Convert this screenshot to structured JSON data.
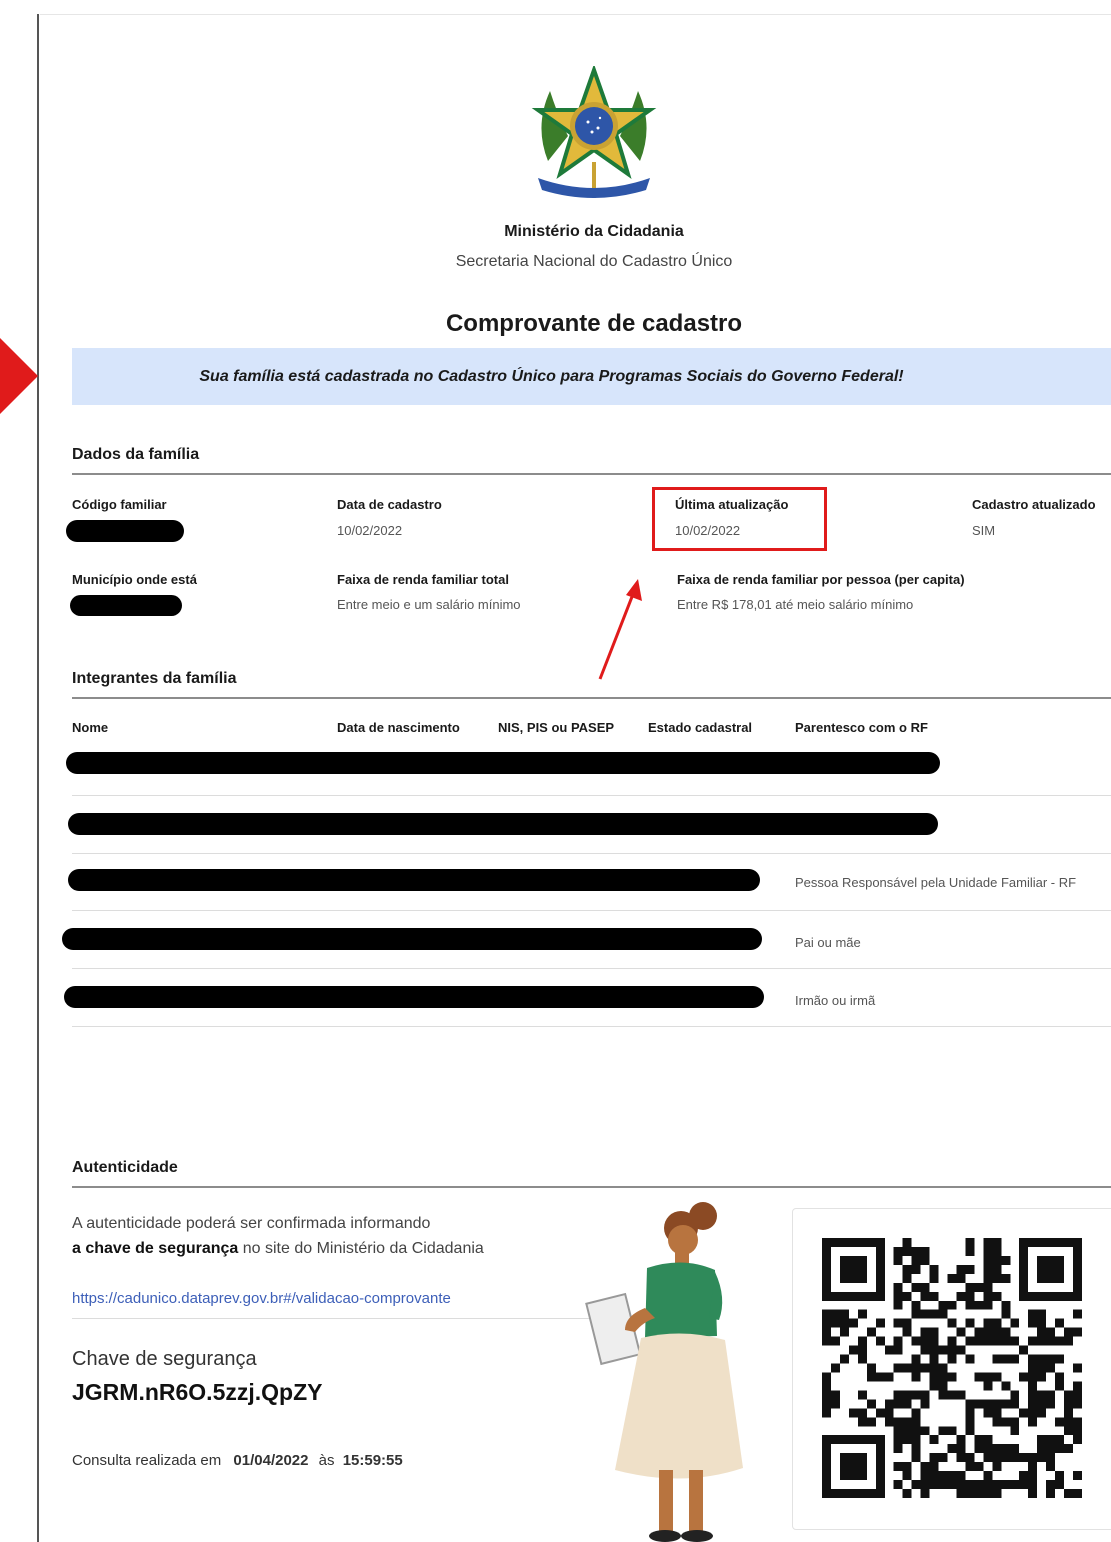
{
  "header": {
    "ministry": "Ministério da Cidadania",
    "secretaria": "Secretaria Nacional do Cadastro Único",
    "title": "Comprovante de cadastro",
    "banner": "Sua família está cadastrada no Cadastro Único para Programas Sociais do Governo Federal!"
  },
  "familia": {
    "section_title": "Dados da família",
    "codigo_label": "Código familiar",
    "data_cadastro_label": "Data de cadastro",
    "data_cadastro_value": "10/02/2022",
    "ultima_label": "Última atualização",
    "ultima_value": "10/02/2022",
    "atualizado_label": "Cadastro atualizado",
    "atualizado_value": "SIM",
    "municipio_label": "Município onde está",
    "renda_total_label": "Faixa de renda familiar total",
    "renda_total_value": "Entre meio e um salário mínimo",
    "renda_pc_label": "Faixa de renda familiar por pessoa (per capita)",
    "renda_pc_value": "Entre R$ 178,01 até meio salário mínimo"
  },
  "integrantes": {
    "section_title": "Integrantes da família",
    "columns": [
      "Nome",
      "Data de nascimento",
      "NIS, PIS ou PASEP",
      "Estado cadastral",
      "Parentesco com o RF"
    ],
    "rows": [
      {
        "parentesco": ""
      },
      {
        "parentesco": ""
      },
      {
        "parentesco": "Pessoa Responsável pela Unidade Familiar - RF"
      },
      {
        "parentesco": "Pai ou mãe"
      },
      {
        "parentesco": "Irmão ou irmã"
      }
    ]
  },
  "autenticidade": {
    "section_title": "Autenticidade",
    "line1": "A autenticidade poderá ser confirmada informando",
    "line2_bold": "a chave de segurança",
    "line2_rest": " no site do Ministério da Cidadania",
    "link": "https://cadunico.dataprev.gov.br#/validacao-comprovante",
    "chave_label": "Chave de segurança",
    "chave_value": "JGRM.nR6O.5zzj.QpZY",
    "consulta_prefix": "Consulta realizada em",
    "consulta_date": "01/04/2022",
    "consulta_mid": "às",
    "consulta_time": "15:59:55"
  },
  "colors": {
    "annotation_red": "#e01b1b",
    "banner_bg": "#d7e5fb",
    "link": "#3d5fb8"
  }
}
